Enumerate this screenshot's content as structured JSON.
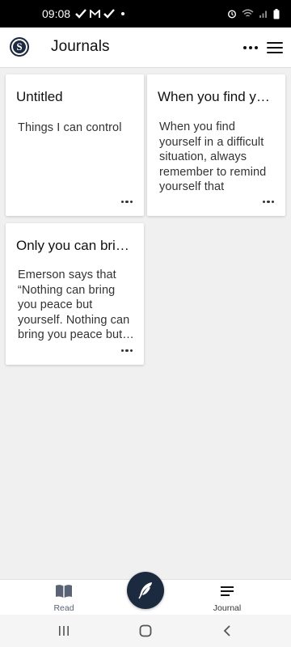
{
  "status_bar": {
    "time": "09:08"
  },
  "app_bar": {
    "logo_letter": "S",
    "title": "Journals"
  },
  "cards": [
    {
      "title": "Untitled",
      "body": "Things I can control"
    },
    {
      "title": "When you find yourself in a difficult situation, always remember to remind yourself",
      "body": "When you find yourself in a difficult situation, always remember to remind yourself that"
    },
    {
      "title": "Only you can bring yourself peace",
      "body": "Emerson says that “Nothing can bring you peace but yourself. Nothing can bring you peace but the triumph"
    }
  ],
  "bottom_nav": {
    "read_label": "Read",
    "journal_label": "Journal"
  },
  "colors": {
    "brand": "#1c2a40",
    "read_icon": "#5a6275",
    "background": "#f0f0f0"
  },
  "icons": [
    "check-icon",
    "gmail-icon",
    "alarm-icon",
    "wifi-icon",
    "signal-icon",
    "battery-icon",
    "book-icon",
    "quill-icon",
    "journal-lines-icon",
    "more-icon",
    "menu-icon"
  ]
}
